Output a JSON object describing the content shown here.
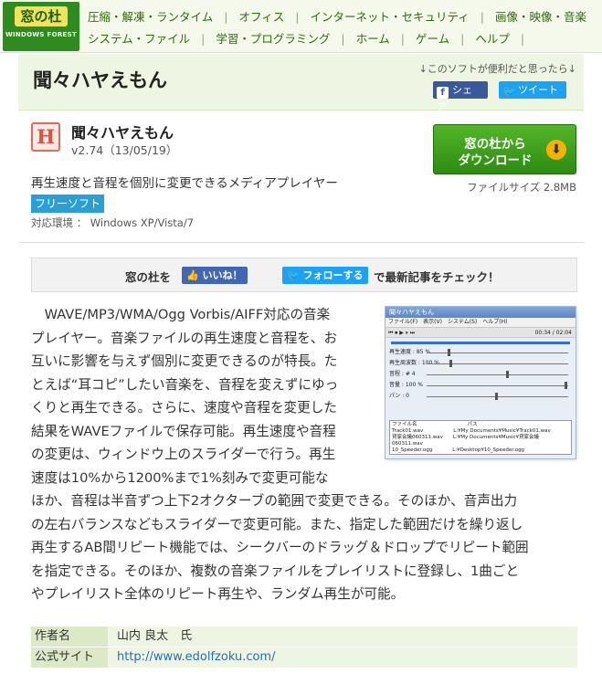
{
  "header": {
    "logo_main": "窓の杜",
    "logo_sub": "WINDOWS FOREST",
    "nav_row1": [
      "圧縮・解凍・ランタイム",
      "オフィス",
      "インターネット・セキュリティ",
      "画像・映像・音楽"
    ],
    "nav_row2": [
      "システム・ファイル",
      "学習・プログラミング",
      "ホーム",
      "ゲーム",
      "ヘルプ"
    ]
  },
  "titlebar": {
    "title": "聞々ハヤえもん",
    "share_note": "↓このソフトが便利だと思ったら↓",
    "share_fb": "シェア",
    "share_tw": "ツイート",
    "fb_icon": "f",
    "tw_icon": "🐦"
  },
  "software": {
    "icon_letter": "H",
    "name": "聞々ハヤえもん",
    "version": "v2.74（13/05/19）",
    "description": "再生速度と音程を個別に変更できるメディアプレイヤー",
    "license": "フリーソフト",
    "environment": "対応環境 ： Windows XP/Vista/7",
    "download_line1": "窓の杜から",
    "download_line2": "ダウンロード",
    "download_icon": "⬇",
    "file_size": "ファイルサイズ 2.8MB"
  },
  "follow": {
    "prefix": "窓の杜を",
    "like": "👍 いいね！",
    "follow": "🐦 フォローする",
    "suffix": "で最新記事をチェック！"
  },
  "article": {
    "lines": [
      "　WAVE/MP3/WMA/Ogg Vorbis/AIFF対応の音楽",
      "プレイヤー。音楽ファイルの再生速度と音程を、お",
      "互いに影響を与えず個別に変更できるのが特長。た",
      "とえば“耳コピ”したい音楽を、音程を変えずにゆっ",
      "くりと再生できる。さらに、速度や音程を変更した",
      "結果をWAVEファイルで保存可能。再生速度や音程",
      "の変更は、ウィンドウ上のスライダーで行う。再生",
      "速度は10%から1200%まで1%刻みで変更可能な",
      "ほか、音程は半音ずつ上下2オクターブの範囲で変更できる。そのほか、音声出力",
      "の左右バランスなどもスライダーで変更可能。また、指定した範囲だけを繰り返し",
      "再生するAB間リピート機能では、シークバーのドラッグ＆ドロップでリピート範囲",
      "を指定できる。そのほか、複数の音楽ファイルをプレイリストに登録し、1曲ごと",
      "やプレイリスト全体のリピート再生や、ランダム再生が可能。"
    ]
  },
  "screenshot": {
    "window_title": "聞々ハヤえもん",
    "menu": "ファイル(F)　表示(V)　システム(S)　ヘルプ(H)",
    "time": "00:34 / 02:04",
    "rows": [
      "再生速度 : 85 %",
      "再生周波数 : 100 %",
      "音程 : # 4",
      "音量 : 100 %",
      "パン : 0"
    ],
    "list_header": "ファイル名　　　　　　　　　　パス",
    "list_items": [
      "Track01.wav　　　　　　L:¥My Documents¥Music¥Track01.wav",
      "貸家会議060311.wav　　L:¥My Documents¥Music¥貸家会議060311.wav",
      "10_Speeder.ogg　　　　L:¥Desktop¥10_Speeder.ogg"
    ]
  },
  "meta": {
    "author_label": "作者名",
    "author_value": "山内 良太　氏",
    "site_label": "公式サイト",
    "site_value": "http://www.edolfzoku.com/"
  }
}
